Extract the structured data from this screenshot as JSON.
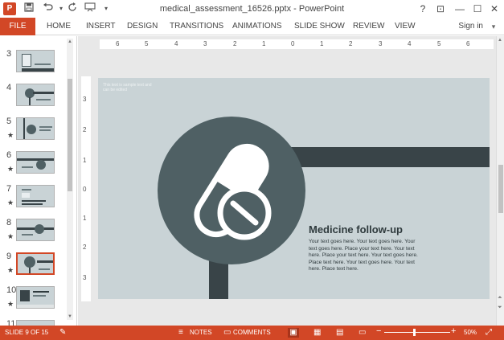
{
  "titlebar": {
    "title": "medical_assessment_16526.pptx - PowerPoint",
    "app_icon": "P",
    "icons": [
      "save-icon",
      "undo-icon",
      "redo-icon",
      "start-from-beginning-icon",
      "customize-icon"
    ],
    "help": "?",
    "restore_ribbon": "⊡",
    "minimize": "—",
    "maximize": "☐",
    "close": "✕"
  },
  "ribbon": {
    "file": "FILE",
    "tabs": [
      "HOME",
      "INSERT",
      "DESIGN",
      "TRANSITIONS",
      "ANIMATIONS",
      "SLIDE SHOW",
      "REVIEW",
      "VIEW"
    ],
    "signin": "Sign in"
  },
  "thumbnails": [
    {
      "num": "3",
      "star": ""
    },
    {
      "num": "4",
      "star": ""
    },
    {
      "num": "5",
      "star": "★"
    },
    {
      "num": "6",
      "star": "★"
    },
    {
      "num": "7",
      "star": "★"
    },
    {
      "num": "8",
      "star": "★"
    },
    {
      "num": "9",
      "star": "★"
    },
    {
      "num": "10",
      "star": "★"
    },
    {
      "num": "11",
      "star": ""
    }
  ],
  "ruler": {
    "h": [
      "6",
      "5",
      "4",
      "3",
      "2",
      "1",
      "0",
      "1",
      "2",
      "3",
      "4",
      "5",
      "6"
    ],
    "v": [
      "3",
      "2",
      "1",
      "0",
      "1",
      "2",
      "3"
    ]
  },
  "slide": {
    "placeholder": "This text is sample text and can be edited",
    "heading": "Medicine follow-up",
    "body": "Your text goes here. Your text goes here. Your text goes here. Place your text here. Your text here. Place your text here. Your text goes here. Place text here. Your text goes here. Your text here. Place text here.",
    "colors": {
      "background": "#c9d3d6",
      "circle": "#4f6064",
      "bar": "#394448",
      "text": "#2f3a3d"
    }
  },
  "statusbar": {
    "slide_info": "SLIDE 9 OF 15",
    "notes": "NOTES",
    "comments": "COMMENTS",
    "zoom_out": "−",
    "zoom_in": "+",
    "zoom": "50%"
  }
}
